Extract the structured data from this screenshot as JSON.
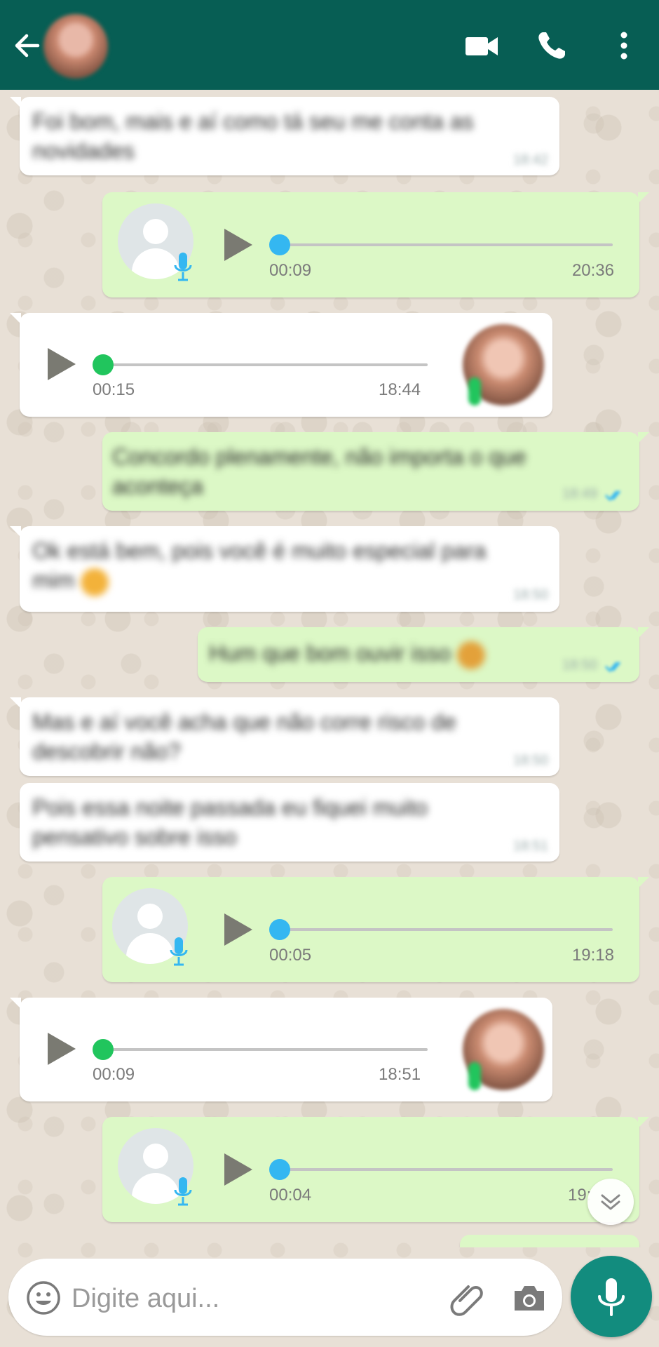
{
  "header": {
    "back_icon": "arrow-left-icon",
    "video_icon": "video-camera-icon",
    "call_icon": "phone-icon",
    "menu_icon": "kebab-menu-icon",
    "background_color": "#075e54"
  },
  "messages": {
    "m1": {
      "text": "Foi bom, mais e aí como tá seu me conta as novidades",
      "time": "18:42"
    },
    "voice1": {
      "duration": "00:09",
      "time": "20:36"
    },
    "voice2": {
      "duration": "00:15",
      "time": "18:44"
    },
    "m2": {
      "text": "Concordo plenamente, não importa o que aconteça",
      "time": "18:49"
    },
    "m3": {
      "text": "Ok está bem, pois você é muito especial para mim",
      "time": "18:50"
    },
    "m4": {
      "text": "Hum que bom ouvir isso",
      "time": "18:50"
    },
    "m5": {
      "text": "Mas e aí você acha que não corre risco de descobrir não?",
      "time": "18:50"
    },
    "m6": {
      "text": "Pois essa noite passada eu fiquei muito pensativo sobre isso",
      "time": "18:51"
    },
    "voice3": {
      "duration": "00:05",
      "time": "19:18"
    },
    "voice4": {
      "duration": "00:09",
      "time": "18:51"
    },
    "voice5": {
      "duration": "00:04",
      "time": "19:"
    }
  },
  "input": {
    "placeholder": "Digite aqui...",
    "emoji_icon": "smiley-icon",
    "attach_icon": "paperclip-icon",
    "camera_icon": "camera-icon",
    "mic_icon": "microphone-icon"
  },
  "colors": {
    "incoming_bubble": "#ffffff",
    "outgoing_bubble": "#dcf8c6",
    "accent": "#128c7e",
    "voice_knob_out": "#34b7f1",
    "voice_knob_in": "#21c55d"
  }
}
